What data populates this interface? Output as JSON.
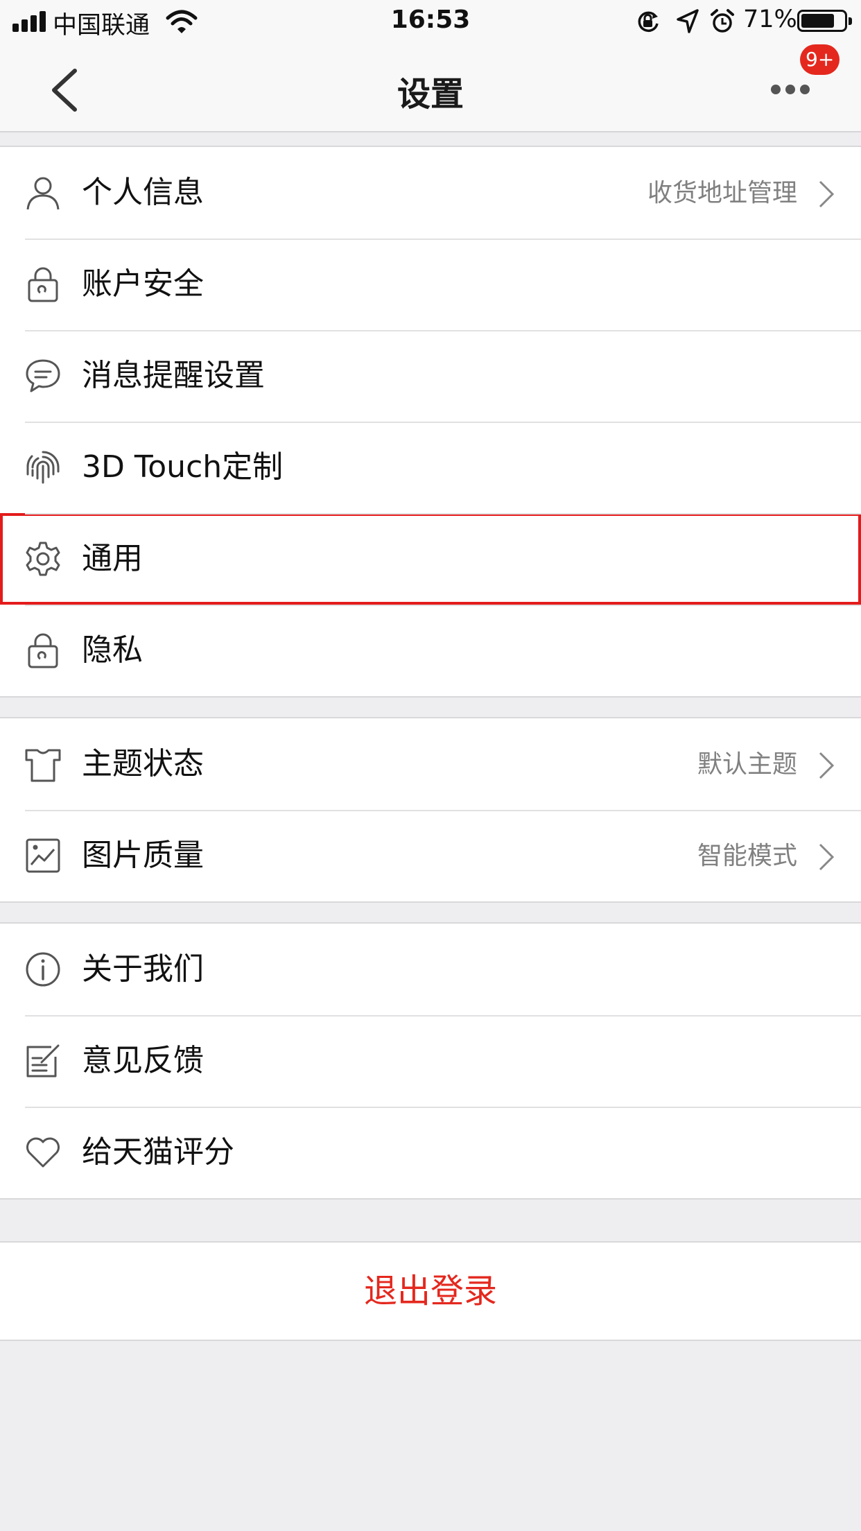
{
  "status_bar": {
    "carrier": "中国联通",
    "time": "16:53",
    "battery_pct": "71%"
  },
  "nav": {
    "title": "设置",
    "badge": "9+"
  },
  "groups": [
    {
      "items": [
        {
          "label": "个人信息",
          "value": "收货地址管理",
          "icon": "person-icon"
        },
        {
          "label": "账户安全",
          "value": "",
          "icon": "lock-icon"
        },
        {
          "label": "消息提醒设置",
          "value": "",
          "icon": "chat-bubble-icon"
        },
        {
          "label": "3D Touch定制",
          "value": "",
          "icon": "fingerprint-icon"
        },
        {
          "label": "通用",
          "value": "",
          "icon": "gear-icon",
          "highlighted": true
        },
        {
          "label": "隐私",
          "value": "",
          "icon": "lock-icon"
        }
      ]
    },
    {
      "items": [
        {
          "label": "主题状态",
          "value": "默认主题",
          "icon": "tshirt-icon"
        },
        {
          "label": "图片质量",
          "value": "智能模式",
          "icon": "image-icon"
        }
      ]
    },
    {
      "items": [
        {
          "label": "关于我们",
          "value": "",
          "icon": "info-icon"
        },
        {
          "label": "意见反馈",
          "value": "",
          "icon": "feedback-icon"
        },
        {
          "label": "给天猫评分",
          "value": "",
          "icon": "heart-icon"
        }
      ]
    }
  ],
  "logout_label": "退出登录",
  "colors": {
    "accent_red": "#e4281e",
    "highlight_border": "#e41b1b",
    "secondary_text": "#808080",
    "icon_gray": "#555555"
  }
}
